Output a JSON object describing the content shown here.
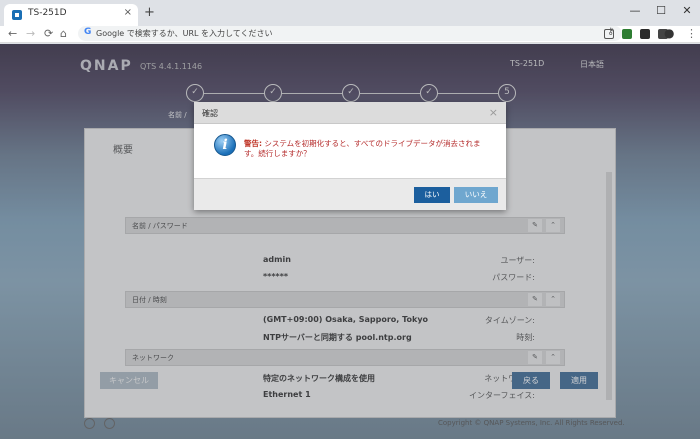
{
  "browser": {
    "tab_title": "TS-251D",
    "tab_close": "×",
    "new_tab": "+",
    "omnibox_placeholder": "Google で検索するか、URL を入力してください",
    "google_glyph": "G",
    "key_glyph": "⚷",
    "win_min": "—",
    "win_max": "☐",
    "win_close": "✕",
    "nav_back": "←",
    "nav_forward": "→",
    "nav_reload": "⟳",
    "nav_home": "⌂",
    "menu_glyph": "⋮",
    "profile_glyph": "●"
  },
  "qnap": {
    "logo": "QNAP",
    "qts_version": "QTS 4.4.1.1146",
    "device_name": "TS-251D",
    "language": "日本語",
    "steps": [
      {
        "symbol": "✓"
      },
      {
        "symbol": "✓"
      },
      {
        "symbol": "✓"
      },
      {
        "symbol": "✓"
      },
      {
        "symbol": "5"
      }
    ],
    "step1_caption": "名前 /",
    "card_title": "概要",
    "sections": {
      "account": {
        "title": "名前 / パスワード",
        "rows": [
          {
            "key": "ユーザー:",
            "value": "admin"
          },
          {
            "key": "パスワード:",
            "value": "******"
          }
        ]
      },
      "datetime": {
        "title": "日付 / 時刻",
        "rows": [
          {
            "key": "タイムゾーン:",
            "value": "(GMT+09:00) Osaka, Sapporo, Tokyo"
          },
          {
            "key": "時刻:",
            "value": "NTPサーバーと同期する pool.ntp.org"
          }
        ]
      },
      "network": {
        "title": "ネットワーク",
        "rows": [
          {
            "key": "ネットワーク:",
            "value": "特定のネットワーク構成を使用"
          },
          {
            "key": "インターフェイス:",
            "value": "Ethernet 1"
          }
        ]
      }
    },
    "edit_glyph": "✎",
    "collapse_glyph": "⌃",
    "cancel_label": "キャンセル",
    "back_label": "戻る",
    "apply_label": "適用",
    "copyright": "Copyright © QNAP Systems, Inc. All Rights Reserved."
  },
  "dialog": {
    "title": "確認",
    "close_glyph": "×",
    "icon_glyph": "i",
    "warning_label": "警告:",
    "message": "システムを初期化すると、すべてのドライブデータが消去されます。続行しますか？",
    "yes_label": "はい",
    "no_label": "いいえ"
  }
}
